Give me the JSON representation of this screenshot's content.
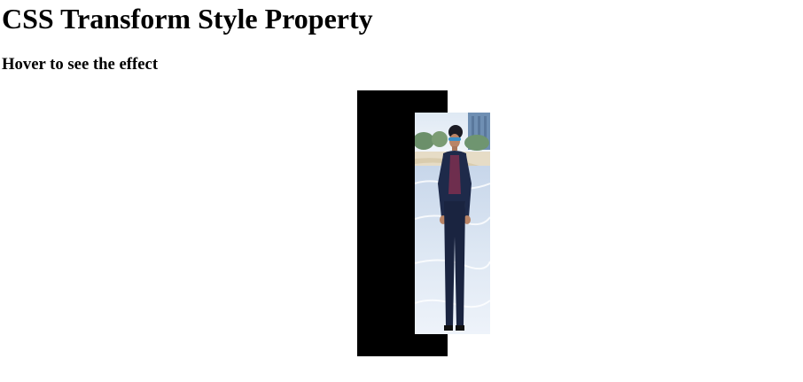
{
  "page": {
    "title": "CSS Transform Style Property",
    "subtitle": "Hover to see the effect"
  },
  "demo": {
    "panel_color": "#000000",
    "photo_subject": "person-standing-on-beach"
  }
}
